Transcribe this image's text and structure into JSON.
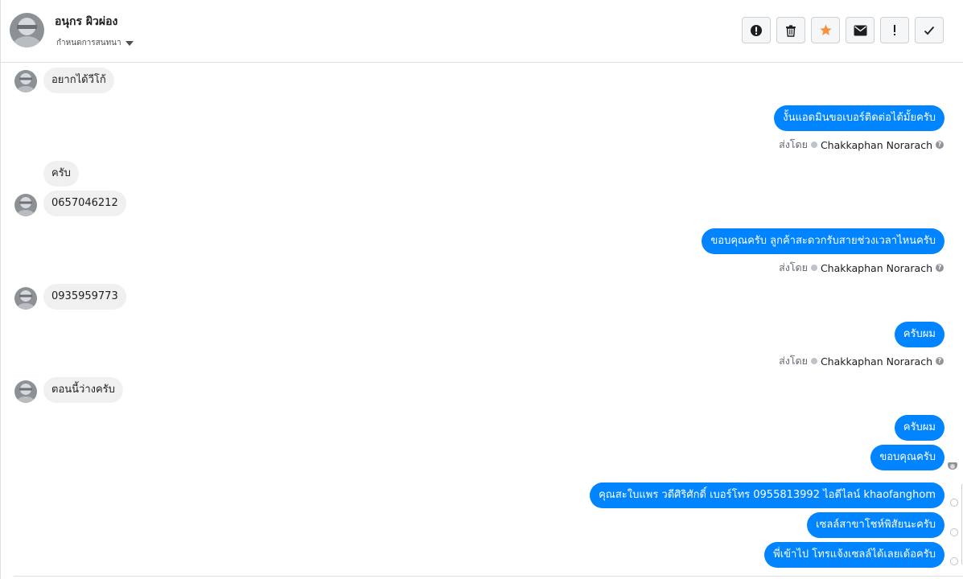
{
  "header": {
    "name": "อนุกร ผิวผ่อง",
    "subtitle": "กำหนดการสนทนา",
    "actions": [
      {
        "icon": "exclamation-circle-icon"
      },
      {
        "icon": "trash-icon"
      },
      {
        "icon": "star-icon",
        "color": "#f7923b"
      },
      {
        "icon": "envelope-icon"
      },
      {
        "icon": "exclamation-icon"
      },
      {
        "icon": "check-icon"
      }
    ]
  },
  "conversation": {
    "sent_by_label": "ส่งโดย",
    "agent_name": "Chakkaphan Norarach",
    "help_glyph": "?",
    "messages": [
      {
        "dir": "in",
        "text": "อยากได้วีโก้"
      },
      {
        "dir": "out",
        "text": "งั้นแอดมินขอเบอร์ติดต่อได้มั้ยครับ"
      },
      {
        "dir": "in",
        "text": "ครับ"
      },
      {
        "dir": "in",
        "text": "0657046212"
      },
      {
        "dir": "out",
        "text": "ขอบคุณครับ ลูกค้าสะดวกรับสายช่วงเวลาไหนครับ"
      },
      {
        "dir": "in",
        "text": "0935959773"
      },
      {
        "dir": "out",
        "text": "ครับผม"
      },
      {
        "dir": "in",
        "text": "ตอนนี้ว่างครับ"
      },
      {
        "dir": "out",
        "text": "ครับผม"
      },
      {
        "dir": "out",
        "text": "ขอบคุณครับ"
      },
      {
        "dir": "out",
        "text": "คุณสะใบแพร วดีศิริศักดิ์       เบอร์โทร 0955813992       ไอดีไลน์  khaofanghom"
      },
      {
        "dir": "out",
        "text": "เซลล์สาขาโชห์พิสัยนะครับ"
      },
      {
        "dir": "out",
        "text": "พี่เข้าไป โทรแจ้งเซลล์ได้เลยเด้อครับ"
      }
    ]
  },
  "colors": {
    "outgoing_bubble": "#0084ff",
    "incoming_bubble": "#f1f0f0",
    "star": "#f7923b"
  }
}
